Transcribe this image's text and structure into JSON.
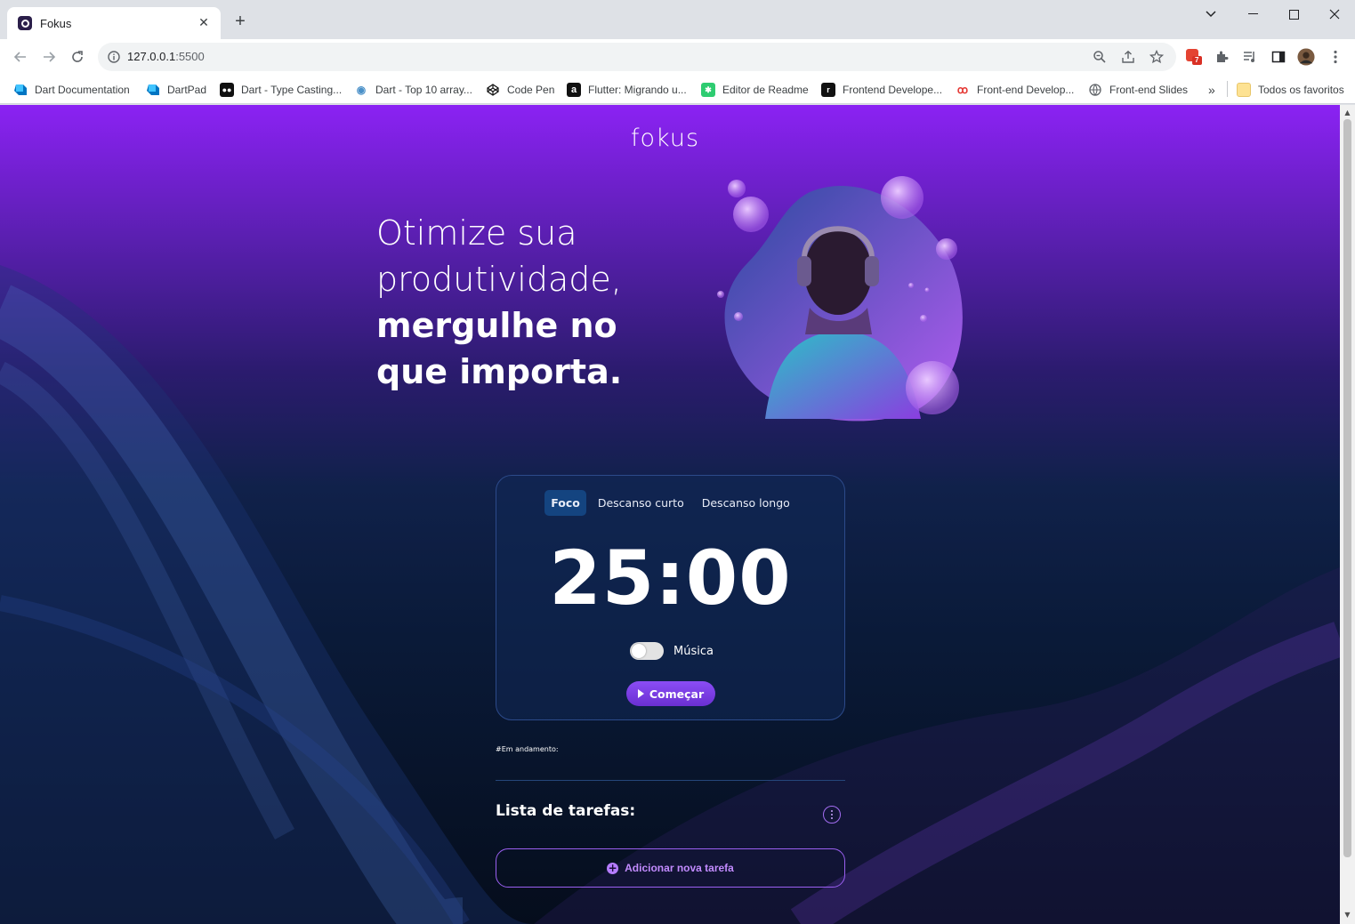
{
  "browser": {
    "tab_title": "Fokus",
    "url_host": "127.0.0.1",
    "url_port": ":5500",
    "extension_badge": "7",
    "bookmarks": [
      {
        "label": "Dart Documentation",
        "color": "#0175c2",
        "icon": "dart-icon"
      },
      {
        "label": "DartPad",
        "color": "#0175c2",
        "icon": "dartpad-icon"
      },
      {
        "label": "Dart - Type Casting...",
        "color": "#111111",
        "icon": "medium-icon"
      },
      {
        "label": "Dart - Top 10 array...",
        "color": "#6aa0c8",
        "icon": "eye-icon"
      },
      {
        "label": "Code Pen",
        "color": "#111111",
        "icon": "codepen-icon"
      },
      {
        "label": "Flutter: Migrando u...",
        "color": "#111111",
        "icon": "alura-icon"
      },
      {
        "label": "Editor de Readme",
        "color": "#2ecc71",
        "icon": "readme-icon"
      },
      {
        "label": "Frontend Develope...",
        "color": "#111111",
        "icon": "roadmap-icon"
      },
      {
        "label": "Front-end Develop...",
        "color": "#e53935",
        "icon": "frontend-icon"
      },
      {
        "label": "Front-end Slides",
        "color": "#5f6368",
        "icon": "globe-icon"
      }
    ],
    "bookmarks_more": "»",
    "all_bookmarks_label": "Todos os favoritos"
  },
  "page": {
    "logo": "fokus",
    "hero_line1": "Otimize sua",
    "hero_line2": "produtividade,",
    "hero_line3": "mergulhe no",
    "hero_line4": "que importa.",
    "modes": [
      "Foco",
      "Descanso curto",
      "Descanso longo"
    ],
    "active_mode": "Foco",
    "timer": "25:00",
    "music_label": "Música",
    "music_enabled": false,
    "start_label": "Começar",
    "in_progress_label": "#Em andamento:",
    "tasks_title": "Lista de tarefas:",
    "add_task_label": "Adicionar nova tarefa"
  }
}
